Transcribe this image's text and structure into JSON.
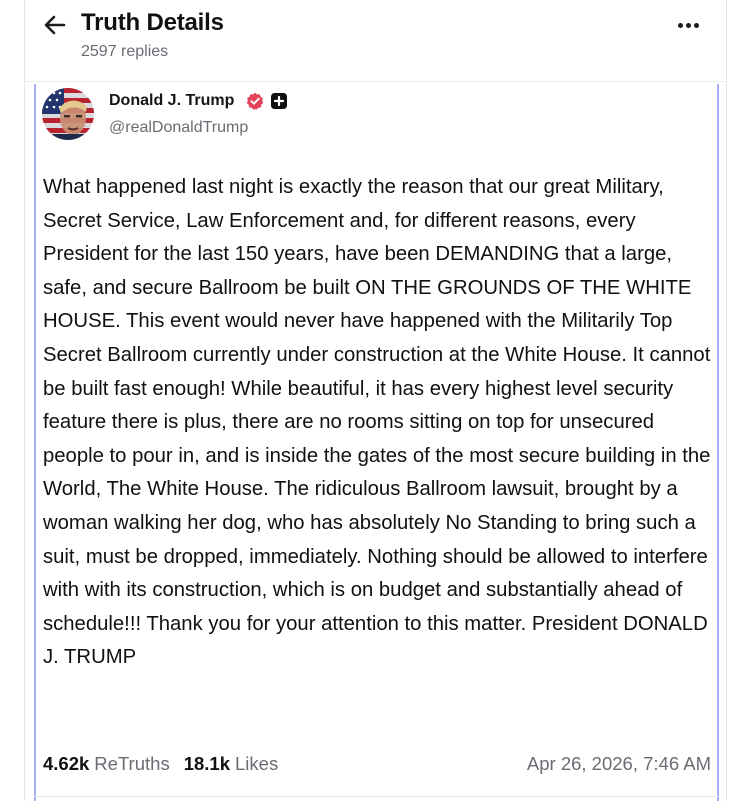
{
  "header": {
    "title": "Truth Details",
    "replies": "2597 replies",
    "back_icon": "arrow-left-icon",
    "more_icon": "more-horizontal-icon"
  },
  "post": {
    "author_name": "Donald J. Trump",
    "author_handle": "@realDonaldTrump",
    "verified_color": "#e4415a",
    "body": "What happened last night is exactly the reason that our great Military, Secret Service, Law Enforcement and, for different reasons, every President for the last 150 years, have been DEMANDING that a large, safe, and secure Ballroom be built ON THE GROUNDS OF THE WHITE HOUSE. This event would never have happened with the Militarily Top Secret Ballroom currently under construction at the White House. It cannot be built fast enough! While beautiful, it has every highest level security feature there is plus, there are no rooms sitting on top for unsecured people to pour in, and is inside the gates of the most secure building in the World, The White House. The ridiculous Ballroom lawsuit, brought by a woman walking her dog, who has absolutely No Standing to bring such a suit, must be dropped, immediately. Nothing should be allowed to interfere with with its construction, which is on budget and substantially ahead of schedule!!! Thank you for your attention to this matter. President DONALD J. TRUMP",
    "retruths_count": "4.62k",
    "retruths_label": "ReTruths",
    "likes_count": "18.1k",
    "likes_label": "Likes",
    "date": "Apr 26, 2026, 7:46 AM"
  },
  "colors": {
    "thread_border": "#a6aef8",
    "muted_text": "#6b6b73"
  }
}
